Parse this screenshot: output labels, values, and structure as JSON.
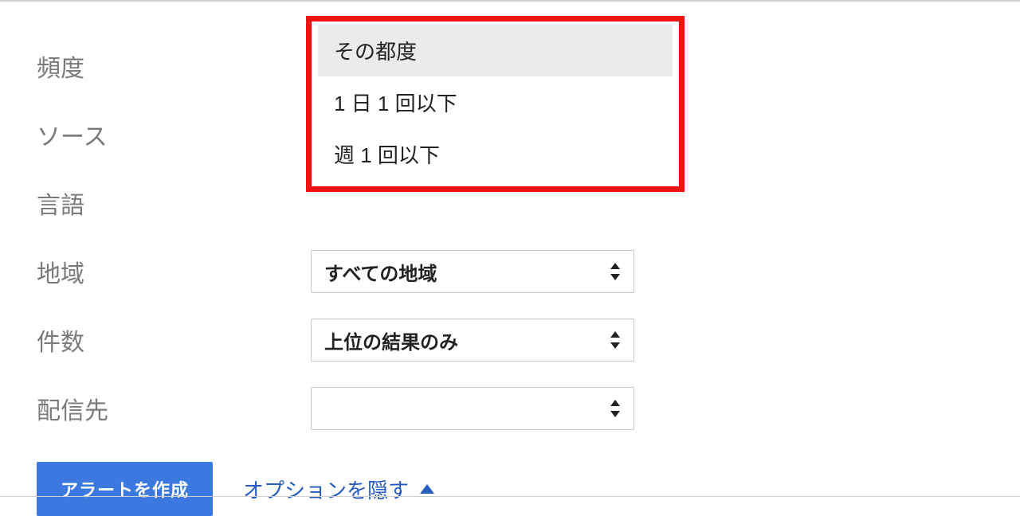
{
  "labels": {
    "frequency": "頻度",
    "source": "ソース",
    "language": "言語",
    "region": "地域",
    "count": "件数",
    "deliver_to": "配信先"
  },
  "dropdown": {
    "options": {
      "opt0": "その都度",
      "opt1": "1 日 1 回以下",
      "opt2": "週 1 回以下"
    }
  },
  "selects": {
    "region": "すべての地域",
    "count": "上位の結果のみ",
    "deliver_to": ""
  },
  "actions": {
    "create_alert": "アラートを作成",
    "hide_options": "オプションを隠す"
  },
  "colors": {
    "primary": "#3b79e0",
    "link": "#275bbf",
    "highlight_border": "#f01111",
    "label_gray": "#7a7a7a"
  }
}
